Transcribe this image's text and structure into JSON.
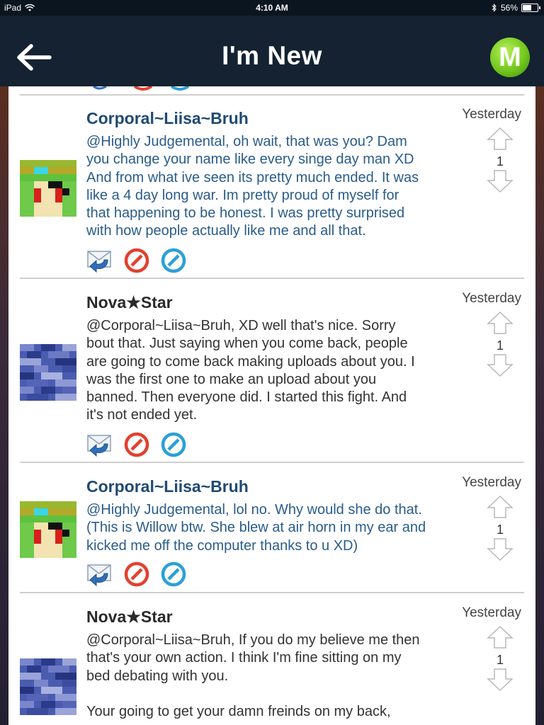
{
  "status_bar": {
    "device": "iPad",
    "time": "4:10 AM",
    "battery": "56%"
  },
  "nav": {
    "title": "I'm New",
    "logo_letter": "M"
  },
  "comments": [
    {
      "author": "Corporal~Liisa~Bruh",
      "time": "Yesterday",
      "votes": "1",
      "text": "@Highly Judgemental, oh wait, that was you? Dam\nyou change your name like every singe day man XD\nAnd from what ive seen its pretty much ended. It was\nlike a 4 day long war. Im pretty proud of myself for\nthat happening to be honest. I was pretty surprised\nwith how people actually like me and all that."
    },
    {
      "author": "Nova★Star",
      "time": "Yesterday",
      "votes": "1",
      "text": "@Corporal~Liisa~Bruh, XD well that's nice. Sorry\nbout that. Just saying when you come back, people\nare going to come back making uploads about you. I\nwas the first one to make an upload about you\nbanned. Then everyone did. I started this fight. And\nit's not ended yet."
    },
    {
      "author": "Corporal~Liisa~Bruh",
      "time": "Yesterday",
      "votes": "1",
      "text": "@Highly Judgemental, lol no. Why would she do that.\n(This is Willow btw. She blew at air horn in my ear and\nkicked me off the computer thanks to u XD)"
    },
    {
      "author": "Nova★Star",
      "time": "Yesterday",
      "votes": "1",
      "text": "@Corporal~Liisa~Bruh, If you do my believe me then\nthat's your own action. I think I'm fine sitting on my\nbed debating with you.\n\nYour going to get your damn freinds on my back,"
    }
  ],
  "colors": {
    "navbar": "#142231",
    "author_blue": "#1f4a73",
    "text_blue": "#2a5c8a",
    "logo_green": "#72c81d",
    "flag_red": "#e2402e",
    "block_blue": "#2aa0d8"
  },
  "icons": [
    "back-arrow-icon",
    "reply-envelope-icon",
    "flag-icon",
    "block-icon",
    "upvote-arrow-icon",
    "downvote-arrow-icon",
    "wifi-icon",
    "bluetooth-icon",
    "battery-icon"
  ]
}
